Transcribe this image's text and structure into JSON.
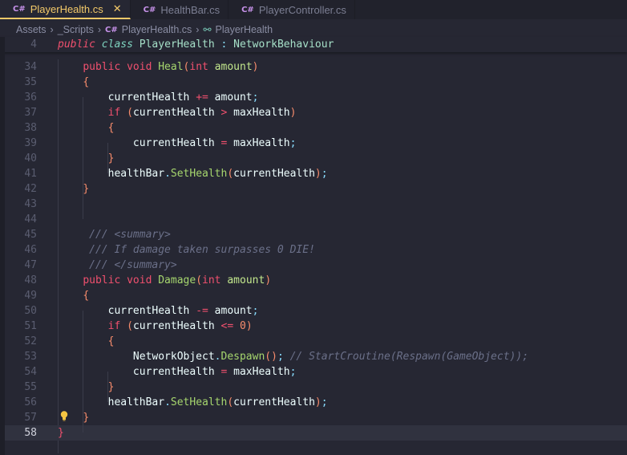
{
  "tabs": [
    {
      "label": "PlayerHealth.cs",
      "active": true
    },
    {
      "label": "HealthBar.cs"
    },
    {
      "label": "PlayerController.cs"
    }
  ],
  "tab_icon": "C#",
  "breadcrumb": [
    "Assets",
    "_Scripts",
    "PlayerHealth.cs",
    "PlayerHealth"
  ],
  "sticky": {
    "num": "4",
    "tokens": [
      [
        "kw",
        "public"
      ],
      [
        "id",
        " "
      ],
      [
        "cls",
        "class"
      ],
      [
        "typ",
        " PlayerHealth "
      ],
      [
        "pn",
        ":"
      ],
      [
        "typ",
        " NetworkBehaviour"
      ]
    ]
  },
  "current_line": 58,
  "lines": [
    {
      "n": 34,
      "t": [
        [
          "id",
          "    "
        ],
        [
          "kw2",
          "public void "
        ],
        [
          "fn",
          "Heal"
        ],
        [
          "br",
          "("
        ],
        [
          "kw2",
          "int "
        ],
        [
          "param",
          "amount"
        ],
        [
          "br",
          ")"
        ]
      ]
    },
    {
      "n": 35,
      "t": [
        [
          "id",
          "    "
        ],
        [
          "br",
          "{"
        ]
      ]
    },
    {
      "n": 36,
      "t": [
        [
          "id",
          "        currentHealth "
        ],
        [
          "op",
          "+="
        ],
        [
          "id",
          " amount"
        ],
        [
          "pn",
          ";"
        ]
      ]
    },
    {
      "n": 37,
      "t": [
        [
          "id",
          "        "
        ],
        [
          "kw2",
          "if "
        ],
        [
          "br",
          "("
        ],
        [
          "id",
          "currentHealth "
        ],
        [
          "op",
          ">"
        ],
        [
          "id",
          " maxHealth"
        ],
        [
          "br",
          ")"
        ]
      ]
    },
    {
      "n": 38,
      "t": [
        [
          "id",
          "        "
        ],
        [
          "br",
          "{"
        ]
      ]
    },
    {
      "n": 39,
      "t": [
        [
          "id",
          "            currentHealth "
        ],
        [
          "op",
          "="
        ],
        [
          "id",
          " maxHealth"
        ],
        [
          "pn",
          ";"
        ]
      ]
    },
    {
      "n": 40,
      "t": [
        [
          "id",
          "        "
        ],
        [
          "br",
          "}"
        ]
      ]
    },
    {
      "n": 41,
      "t": [
        [
          "id",
          "        healthBar"
        ],
        [
          "pn",
          "."
        ],
        [
          "fn",
          "SetHealth"
        ],
        [
          "br",
          "("
        ],
        [
          "id",
          "currentHealth"
        ],
        [
          "br",
          ")"
        ],
        [
          "pn",
          ";"
        ]
      ]
    },
    {
      "n": 42,
      "t": [
        [
          "id",
          "    "
        ],
        [
          "br",
          "}"
        ]
      ]
    },
    {
      "n": 43,
      "t": []
    },
    {
      "n": 44,
      "t": []
    },
    {
      "n": 45,
      "t": [
        [
          "cm",
          "     /// <summary>"
        ]
      ]
    },
    {
      "n": 46,
      "t": [
        [
          "cm",
          "     /// If damage taken surpasses 0 DIE!"
        ]
      ]
    },
    {
      "n": 47,
      "t": [
        [
          "cm",
          "     /// </summary>"
        ]
      ]
    },
    {
      "n": 48,
      "t": [
        [
          "id",
          "    "
        ],
        [
          "kw2",
          "public void "
        ],
        [
          "fn",
          "Damage"
        ],
        [
          "br",
          "("
        ],
        [
          "kw2",
          "int "
        ],
        [
          "param",
          "amount"
        ],
        [
          "br",
          ")"
        ]
      ]
    },
    {
      "n": 49,
      "t": [
        [
          "id",
          "    "
        ],
        [
          "br",
          "{"
        ]
      ]
    },
    {
      "n": 50,
      "t": [
        [
          "id",
          "        currentHealth "
        ],
        [
          "op",
          "-="
        ],
        [
          "id",
          " amount"
        ],
        [
          "pn",
          ";"
        ]
      ]
    },
    {
      "n": 51,
      "t": [
        [
          "id",
          "        "
        ],
        [
          "kw2",
          "if "
        ],
        [
          "br",
          "("
        ],
        [
          "id",
          "currentHealth "
        ],
        [
          "op",
          "<="
        ],
        [
          "id",
          " "
        ],
        [
          "num",
          "0"
        ],
        [
          "br",
          ")"
        ]
      ]
    },
    {
      "n": 52,
      "t": [
        [
          "id",
          "        "
        ],
        [
          "br",
          "{"
        ]
      ]
    },
    {
      "n": 53,
      "t": [
        [
          "id",
          "            NetworkObject"
        ],
        [
          "pn",
          "."
        ],
        [
          "fn",
          "Despawn"
        ],
        [
          "br",
          "()"
        ],
        [
          "pn",
          ";"
        ],
        [
          "cm",
          " // StartCroutine(Respawn(GameObject));"
        ]
      ]
    },
    {
      "n": 54,
      "t": [
        [
          "id",
          "            currentHealth "
        ],
        [
          "op",
          "="
        ],
        [
          "id",
          " maxHealth"
        ],
        [
          "pn",
          ";"
        ]
      ]
    },
    {
      "n": 55,
      "t": [
        [
          "id",
          "        "
        ],
        [
          "br",
          "}"
        ]
      ]
    },
    {
      "n": 56,
      "t": [
        [
          "id",
          "        healthBar"
        ],
        [
          "pn",
          "."
        ],
        [
          "fn",
          "SetHealth"
        ],
        [
          "br",
          "("
        ],
        [
          "id",
          "currentHealth"
        ],
        [
          "br",
          ")"
        ],
        [
          "pn",
          ";"
        ]
      ]
    },
    {
      "n": 57,
      "t": [
        [
          "id",
          "    "
        ],
        [
          "br",
          "}"
        ]
      ]
    },
    {
      "n": 58,
      "t": [
        [
          "op",
          "}"
        ]
      ]
    }
  ]
}
